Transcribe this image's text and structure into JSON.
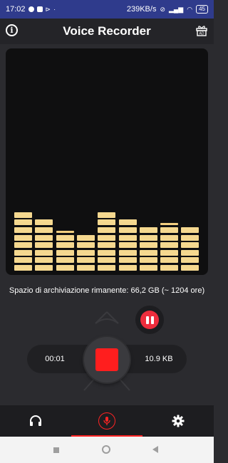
{
  "status_bar": {
    "time": "17:02",
    "network_speed": "239KB/s",
    "battery": "45"
  },
  "app_bar": {
    "title": "Voice Recorder",
    "left_icon": "info-icon",
    "right_icon": "ad-gift-icon"
  },
  "visualizer": {
    "bar_color": "#f5d88f",
    "background": "#0f0f10",
    "columns": [
      {
        "level": 8,
        "peak": false
      },
      {
        "level": 7,
        "peak": false
      },
      {
        "level": 5,
        "peak": true
      },
      {
        "level": 5,
        "peak": false
      },
      {
        "level": 8,
        "peak": false
      },
      {
        "level": 7,
        "peak": false
      },
      {
        "level": 6,
        "peak": false
      },
      {
        "level": 6,
        "peak": true
      },
      {
        "level": 6,
        "peak": false
      }
    ]
  },
  "storage": {
    "text": "Spazio di archiviazione rimanente: 66,2 GB (~ 1204 ore)"
  },
  "recorder": {
    "elapsed": "00:01",
    "file_size": "10.9 KB",
    "record_color": "#ff1e1e",
    "pause_color": "#ee2d3d"
  },
  "bottom_nav": {
    "items": [
      {
        "icon": "headphones-icon",
        "active": false
      },
      {
        "icon": "microphone-icon",
        "active": true
      },
      {
        "icon": "gear-icon",
        "active": false
      }
    ],
    "accent": "#ff2424"
  },
  "system_nav": {
    "icons": [
      "recents-icon",
      "home-icon",
      "back-icon"
    ]
  }
}
